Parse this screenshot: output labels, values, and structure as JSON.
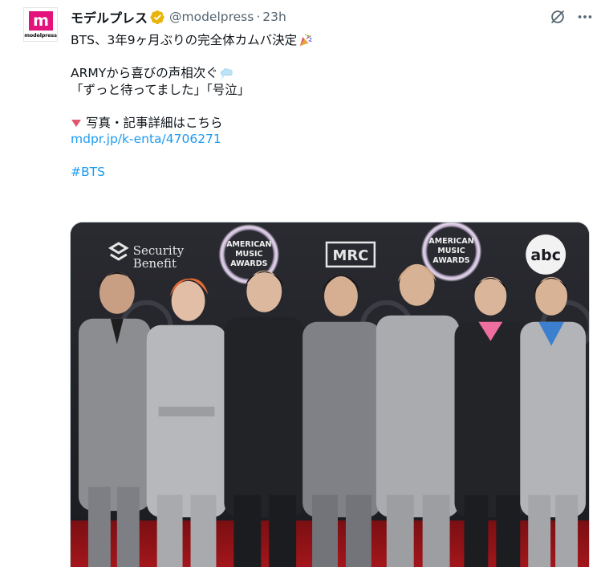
{
  "tweet": {
    "display_name": "モデルプレス",
    "handle": "@modelpress",
    "separator": "·",
    "time": "23h",
    "avatar": {
      "letter": "m",
      "brand": "modelpress",
      "color": "#e4137b"
    },
    "verified_color": "#e8b50c",
    "icons": [
      "grok-icon",
      "more-icon"
    ],
    "lines": [
      "BTS、3年9ヶ月ぶりの完全体カムバ決定",
      "ARMYから喜びの声相次ぐ",
      "「ずっと待ってました」「号泣」",
      "写真・記事詳細はこちら"
    ],
    "emojis": [
      "party-popper-icon",
      "thought-bubble-icon",
      "red-triangle-icon"
    ],
    "link": "mdpr.jp/k-enta/4706271",
    "hashtag": "#BTS",
    "link_color": "#1d9bf0",
    "photo": {
      "backdrop_logos": [
        "Security Benefit",
        "AMERICAN MUSIC AWARDS",
        "MRC",
        "AMERICAN MUSIC AWARDS",
        "abc",
        "AMERICAN MUSIC AWARDS",
        "MUSIC AWARDS"
      ],
      "brand_security_line1": "Security",
      "brand_security_line2": "Benefit",
      "ama_line1": "AMERICAN",
      "ama_line2": "MUSIC",
      "ama_line3": "AWARDS",
      "mrc": "MRC",
      "abc": "abc"
    }
  }
}
